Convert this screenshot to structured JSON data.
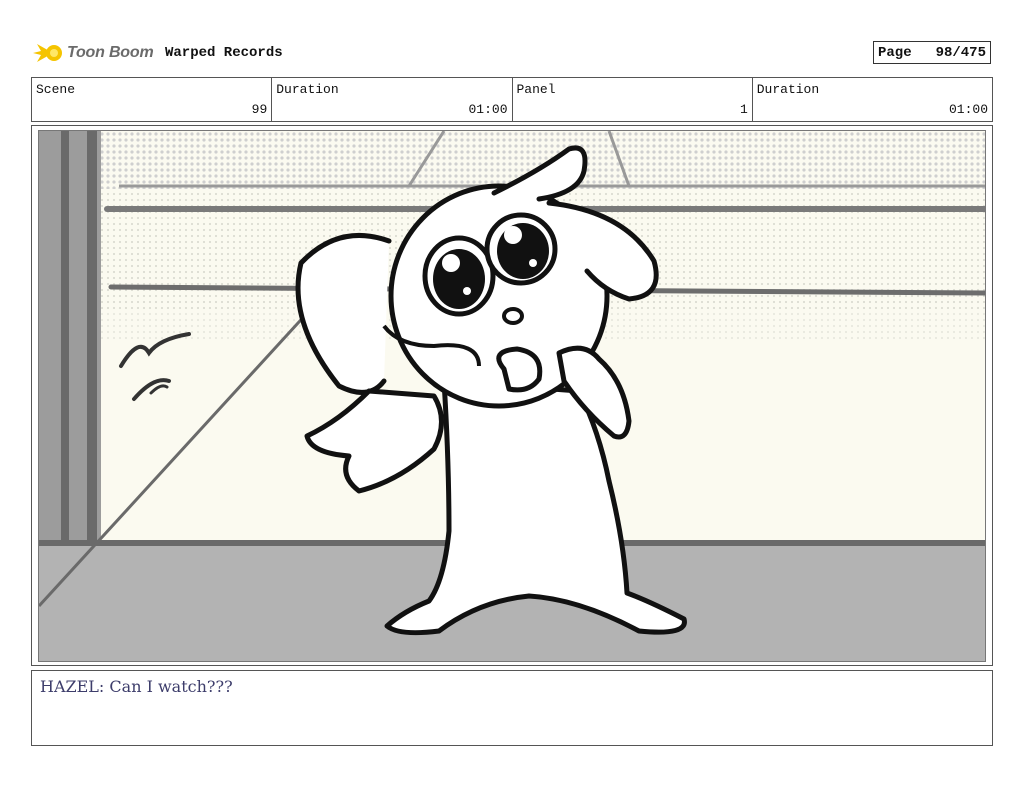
{
  "header": {
    "logo_text": "Toon Boom",
    "project_title": "Warped Records",
    "page_label": "Page",
    "page_value": "98/475"
  },
  "info": {
    "scene_label": "Scene",
    "scene_value": "99",
    "scene_duration_label": "Duration",
    "scene_duration_value": "01:00",
    "panel_label": "Panel",
    "panel_value": "1",
    "panel_duration_label": "Duration",
    "panel_duration_value": "01:00"
  },
  "panel": {
    "dialogue": "HAZEL: Can I watch???"
  },
  "colors": {
    "logo_yellow": "#f5c400",
    "dialogue_text": "#3d3d6b",
    "floor_gray": "#b3b3b3"
  }
}
